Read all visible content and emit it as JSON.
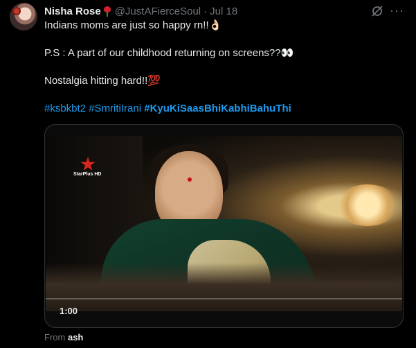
{
  "tweet": {
    "author_name": "Nisha Rose",
    "handle": "@JustAFierceSoul",
    "separator": "·",
    "date": "Jul 18",
    "lines": [
      "Indians moms are just so happy rn!!👌🏻",
      "P.S : A part of our childhood returning on screens??👀",
      "Nostalgia hitting hard!!💯"
    ],
    "hashtags": [
      "#ksbkbt2",
      "#SmritiIrani",
      "#KyuKiSaasBhiKabhiBahuThi"
    ],
    "media": {
      "channel_logo_text": "StarPlus HD",
      "duration": "1:00",
      "progress": 0
    },
    "source_prefix": "From",
    "source_app": "ash"
  },
  "icons": {
    "grok": "grok-icon",
    "more": "more-icon",
    "rose": "rose-emoji-icon",
    "starplus": "starplus-logo-icon"
  },
  "colors": {
    "background": "#000000",
    "text": "#e7e9ea",
    "muted": "#71767b",
    "link": "#1d9bf0",
    "border": "#2f3336"
  }
}
